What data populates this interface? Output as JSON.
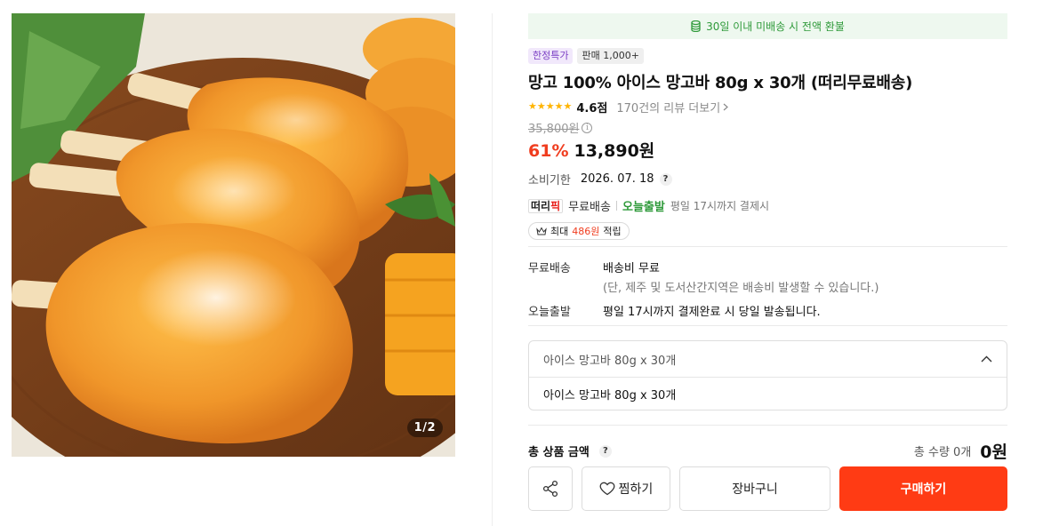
{
  "gallery": {
    "counter": "1/2",
    "image_alt": "mango-ice-bars-photo"
  },
  "refund_banner": {
    "text": "30일 이내 미배송 시 전액 환불",
    "icon": "coin-stack-icon"
  },
  "badges": {
    "limited": "한정특가",
    "sales": "판매 1,000+"
  },
  "product": {
    "title": "망고 100% 아이스 망고바 80g x 30개 (떠리무료배송)"
  },
  "rating": {
    "stars": 5,
    "score": "4.6점",
    "review_link": "170건의 리뷰 더보기"
  },
  "pricing": {
    "original": "35,800원",
    "discount": "61%",
    "price": "13,890원"
  },
  "expiry": {
    "label": "소비기한",
    "date": "2026. 07. 18",
    "help": "?"
  },
  "shipping": {
    "logo_black": "떠리",
    "logo_red": "픽",
    "free": "무료배송",
    "today": "오늘출발",
    "today_desc": "평일 17시까지 결제시"
  },
  "points": {
    "prefix": "최대",
    "amount": "486원",
    "suffix": "적립"
  },
  "delivery": {
    "free_label": "무료배송",
    "free_value": "배송비 무료",
    "free_note": "(단, 제주 및 도서산간지역은 배송비 발생할 수 있습니다.)",
    "today_label": "오늘출발",
    "today_value": "평일 17시까지 결제완료 시 당일 발송됩니다."
  },
  "option": {
    "selected": "아이스 망고바 80g x 30개",
    "items": [
      "아이스 망고바 80g x 30개"
    ]
  },
  "total": {
    "label": "총 상품 금액",
    "help": "?",
    "qty": "총 수량 0개",
    "price": "0원"
  },
  "actions": {
    "wish": "찜하기",
    "cart": "장바구니",
    "buy": "구매하기"
  },
  "colors": {
    "accent": "#ff3b14",
    "discount": "#f03d1f",
    "green": "#2f9a3a",
    "star": "#ffb400"
  }
}
